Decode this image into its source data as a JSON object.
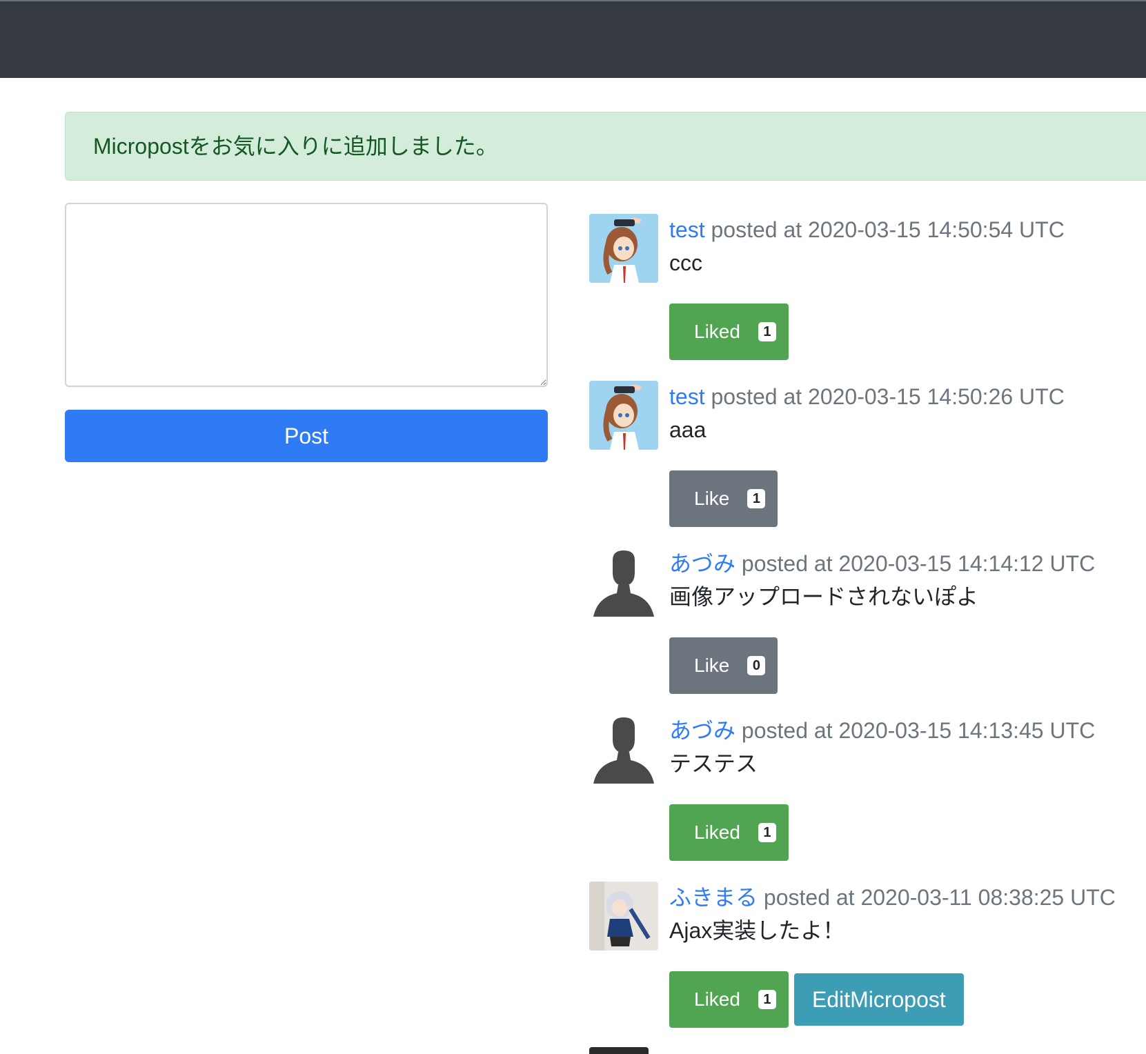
{
  "alert": {
    "message": "Micropostをお気に入りに追加しました。"
  },
  "form": {
    "textarea_value": "",
    "post_label": "Post"
  },
  "colors": {
    "primary": "#2f7bf5",
    "liked": "#51a552",
    "like": "#6c757d",
    "edit": "#3c9db4",
    "navbar": "#343a40"
  },
  "posts": [
    {
      "user": "test",
      "meta": " posted at 2020-03-15 14:50:54 UTC",
      "content": "ccc",
      "like_label": "Liked",
      "like_count": "1",
      "liked": true,
      "avatar": "anime-girl-1"
    },
    {
      "user": "test",
      "meta": " posted at 2020-03-15 14:50:26 UTC",
      "content": "aaa",
      "like_label": "Like",
      "like_count": "1",
      "liked": false,
      "avatar": "anime-girl-1"
    },
    {
      "user": "あづみ",
      "meta": " posted at 2020-03-15 14:14:12 UTC",
      "content": "画像アップロードされないぽよ",
      "like_label": "Like",
      "like_count": "0",
      "liked": false,
      "avatar": "default-user"
    },
    {
      "user": "あづみ",
      "meta": " posted at 2020-03-15 14:13:45 UTC",
      "content": "テステス",
      "like_label": "Liked",
      "like_count": "1",
      "liked": true,
      "avatar": "default-user"
    },
    {
      "user": "ふきまる",
      "meta": " posted at 2020-03-11 08:38:25 UTC",
      "content": "Ajax実装したよ！",
      "like_label": "Liked",
      "like_count": "1",
      "liked": true,
      "avatar": "figure-photo",
      "edit_label": "EditMicropost"
    }
  ]
}
